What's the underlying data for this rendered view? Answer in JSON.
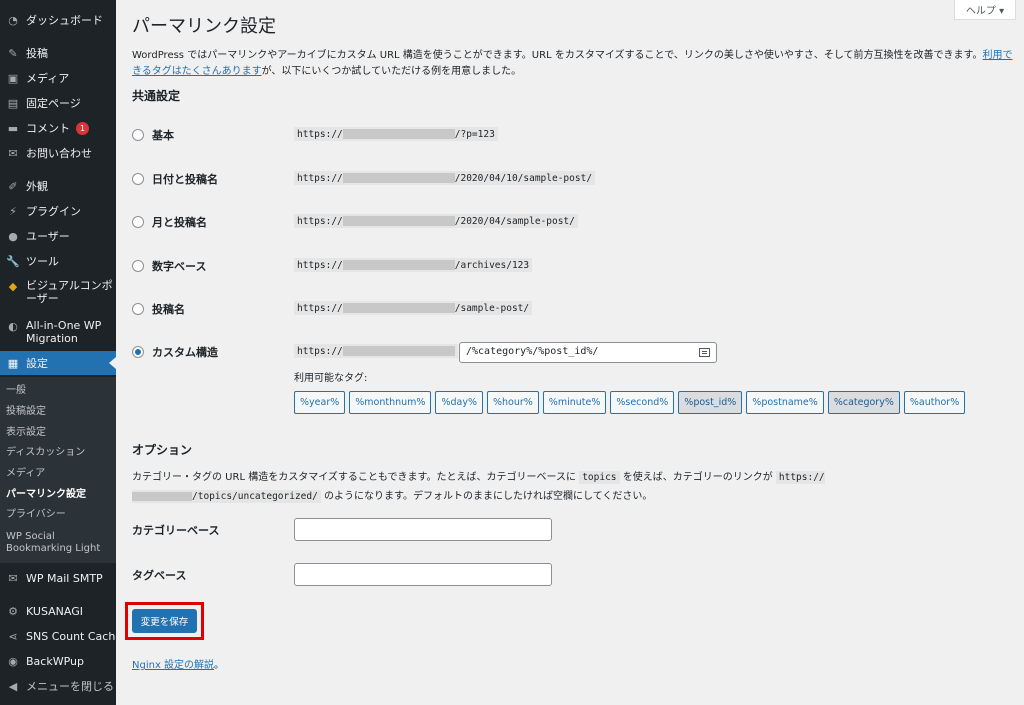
{
  "sidebar": {
    "items": [
      {
        "label": "ダッシュボード",
        "icon": "dashboard-icon"
      },
      {
        "label": "投稿",
        "icon": "pin-icon"
      },
      {
        "label": "メディア",
        "icon": "media-icon"
      },
      {
        "label": "固定ページ",
        "icon": "page-icon"
      },
      {
        "label": "コメント",
        "icon": "comment-icon",
        "badge": "1"
      },
      {
        "label": "お問い合わせ",
        "icon": "mail-icon"
      },
      {
        "label": "外観",
        "icon": "brush-icon"
      },
      {
        "label": "プラグイン",
        "icon": "plugin-icon"
      },
      {
        "label": "ユーザー",
        "icon": "user-icon"
      },
      {
        "label": "ツール",
        "icon": "wrench-icon"
      },
      {
        "label": "ビジュアルコンポーザー",
        "icon": "visual-composer-icon"
      },
      {
        "label": "All-in-One WP Migration",
        "icon": "migration-icon"
      },
      {
        "label": "設定",
        "icon": "settings-icon"
      },
      {
        "label": "WP Mail SMTP",
        "icon": "envelope-icon"
      },
      {
        "label": "KUSANAGI",
        "icon": "gear-icon"
      },
      {
        "label": "SNS Count Cache",
        "icon": "share-icon"
      },
      {
        "label": "BackWPup",
        "icon": "backup-icon"
      },
      {
        "label": "メニューを閉じる",
        "icon": "collapse-icon"
      }
    ],
    "submenu": [
      "一般",
      "投稿設定",
      "表示設定",
      "ディスカッション",
      "メディア",
      "パーマリンク設定",
      "プライバシー",
      "WP Social Bookmarking Light"
    ]
  },
  "header": {
    "help_label": "ヘルプ ▾",
    "title": "パーマリンク設定"
  },
  "intro": {
    "text_before": "WordPress ではパーマリンクやアーカイブにカスタム URL 構造を使うことができます。URL をカスタマイズすることで、リンクの美しさや使いやすさ、そして前方互換性を改善できます。",
    "link_text": "利用できるタグはたくさんあります",
    "text_after": "が、以下にいくつか試していただける例を用意しました。"
  },
  "common_settings": {
    "heading": "共通設定",
    "options": [
      {
        "label": "基本",
        "prefix": "https://",
        "suffix": "/?p=123",
        "checked": false
      },
      {
        "label": "日付と投稿名",
        "prefix": "https://",
        "suffix": "/2020/04/10/sample-post/",
        "checked": false
      },
      {
        "label": "月と投稿名",
        "prefix": "https://",
        "suffix": "/2020/04/sample-post/",
        "checked": false
      },
      {
        "label": "数字ベース",
        "prefix": "https://",
        "suffix": "/archives/123",
        "checked": false
      },
      {
        "label": "投稿名",
        "prefix": "https://",
        "suffix": "/sample-post/",
        "checked": false
      },
      {
        "label": "カスタム構造",
        "prefix": "https://",
        "suffix": "",
        "checked": true
      }
    ],
    "custom_structure_value": "/%category%/%post_id%/",
    "available_tags_label": "利用可能なタグ:",
    "tags": [
      {
        "label": "%year%",
        "active": false
      },
      {
        "label": "%monthnum%",
        "active": false
      },
      {
        "label": "%day%",
        "active": false
      },
      {
        "label": "%hour%",
        "active": false
      },
      {
        "label": "%minute%",
        "active": false
      },
      {
        "label": "%second%",
        "active": false
      },
      {
        "label": "%post_id%",
        "active": true
      },
      {
        "label": "%postname%",
        "active": false
      },
      {
        "label": "%category%",
        "active": true
      },
      {
        "label": "%author%",
        "active": false
      }
    ]
  },
  "options": {
    "heading": "オプション",
    "desc_1": "カテゴリー・タグの URL 構造をカスタマイズすることもできます。たとえば、カテゴリーベースに",
    "desc_code_1": "topics",
    "desc_2": "を使えば、カテゴリーのリンクが",
    "desc_code_2a": "https://",
    "desc_code_2b": "/topics/uncategorized/",
    "desc_3": "のようになります。デフォルトのままにしたければ空欄にしてください。",
    "category_base_label": "カテゴリーベース",
    "category_base_value": "",
    "tag_base_label": "タグベース",
    "tag_base_value": ""
  },
  "save_button_label": "変更を保存",
  "nginx": {
    "link_text": "Nginx 設定の解説",
    "suffix": "。"
  },
  "colors": {
    "accent": "#2271b1",
    "sidebar_bg": "#1d2327",
    "highlight": "#e00000"
  }
}
